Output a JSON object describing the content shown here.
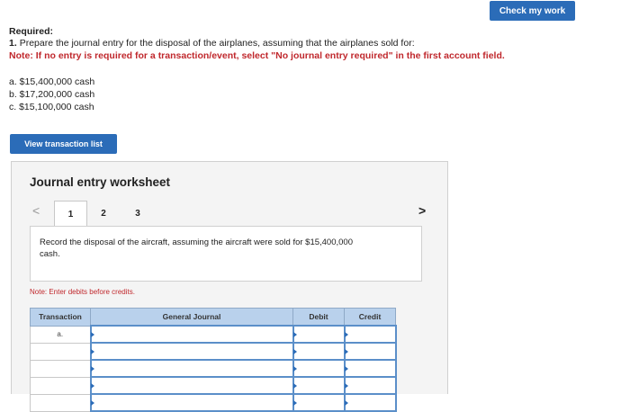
{
  "header": {
    "check_my_work_label": "Check my work"
  },
  "required": {
    "heading": "Required:",
    "question_num": "1.",
    "question_text": "Prepare the journal entry for the disposal of the airplanes, assuming that the airplanes sold for:",
    "note": "Note: If no entry is required for a transaction/event, select \"No journal entry required\" in the first account field."
  },
  "options": [
    "a.  $15,400,000 cash",
    "b.  $17,200,000 cash",
    "c.  $15,100,000 cash"
  ],
  "view_transaction_list_label": "View transaction list",
  "worksheet": {
    "title": "Journal entry worksheet",
    "tabs": [
      "1",
      "2",
      "3"
    ],
    "active_tab": "1",
    "record_text": "Record the disposal of the aircraft, assuming the aircraft were sold for $15,400,000 cash.",
    "note": "Note: Enter debits before credits.",
    "table": {
      "headers": [
        "Transaction",
        "General Journal",
        "Debit",
        "Credit"
      ],
      "rows": [
        {
          "transaction": "a."
        },
        {
          "transaction": ""
        },
        {
          "transaction": ""
        },
        {
          "transaction": ""
        },
        {
          "transaction": ""
        }
      ]
    }
  },
  "colors": {
    "accent": "#2b6cb8",
    "note_red": "#c0282d",
    "header_blue": "#b9d1ec"
  }
}
